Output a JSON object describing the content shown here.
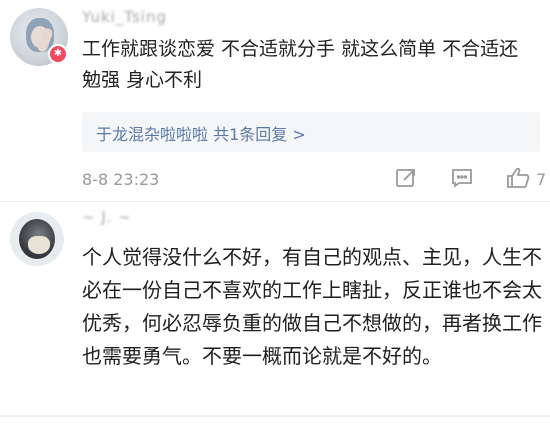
{
  "comments": [
    {
      "username": "Yuki_Tsing",
      "text": "工作就跟谈恋爱 不合适就分手 就这么简单 不合适还勉强 身心不利",
      "reply_summary": "于龙混杂啦啦啦 共1条回复 >",
      "timestamp": "8-8 23:23",
      "like_count": "7"
    },
    {
      "username": "~ J. ~",
      "text": "个人觉得没什么不好，有自己的观点、主见，人生不必在一份自己不喜欢的工作上瞎扯，反正谁也不会太优秀，何必忍辱负重的做自己不想做的，再者换工作也需要勇气。不要一概而论就是不好的。"
    }
  ],
  "icons": [
    "share-icon",
    "comment-icon",
    "like-icon"
  ],
  "colors": {
    "link": "#5b79a8",
    "meta": "#9a9a9a",
    "badge": "#f2495d"
  }
}
